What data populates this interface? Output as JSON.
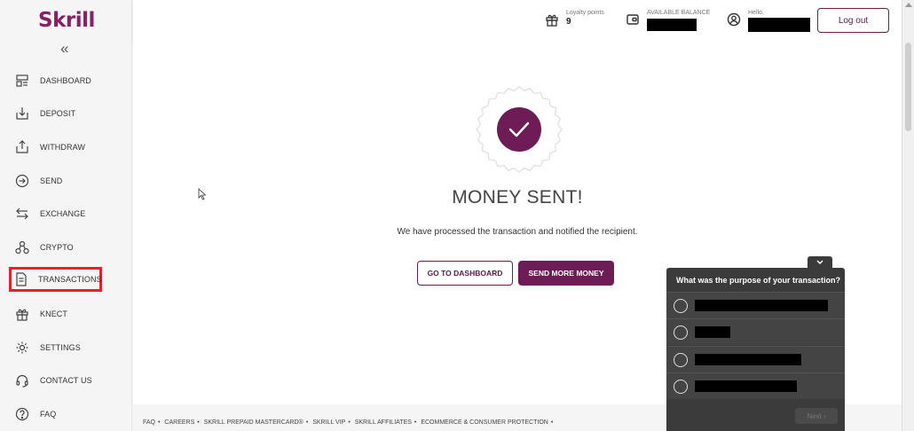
{
  "brand": {
    "logo": "Skrill",
    "accent": "#6d1c55"
  },
  "sidebar": {
    "collapse_icon": "double-chevron-left-icon",
    "items": [
      {
        "label": "DASHBOARD",
        "icon": "dashboard-icon"
      },
      {
        "label": "DEPOSIT",
        "icon": "deposit-icon"
      },
      {
        "label": "WITHDRAW",
        "icon": "withdraw-icon"
      },
      {
        "label": "SEND",
        "icon": "send-icon"
      },
      {
        "label": "EXCHANGE",
        "icon": "exchange-icon"
      },
      {
        "label": "CRYPTO",
        "icon": "crypto-icon"
      },
      {
        "label": "TRANSACTIONS",
        "icon": "transactions-icon",
        "highlighted": true
      },
      {
        "label": "KNECT",
        "icon": "gift-icon"
      },
      {
        "label": "SETTINGS",
        "icon": "gear-icon"
      },
      {
        "label": "CONTACT US",
        "icon": "headset-icon"
      },
      {
        "label": "FAQ",
        "icon": "question-icon"
      }
    ]
  },
  "header": {
    "loyalty_label": "Loyalty points",
    "loyalty_value": "9",
    "balance_label": "AVAILABLE BALANCE",
    "hello_label": "Hello,",
    "logout_label": "Log out"
  },
  "main": {
    "title": "MONEY SENT!",
    "subtitle": "We have processed the transaction and notified the recipient.",
    "btn_dashboard": "GO TO DASHBOARD",
    "btn_send_more": "SEND MORE MONEY"
  },
  "footer": {
    "links": [
      "FAQ",
      "CAREERS",
      "SKRILL PREPAID MASTERCARD®",
      "SKRILL VIP",
      "SKRILL AFFILIATES",
      "ECOMMERCE & CONSUMER PROTECTION"
    ]
  },
  "survey": {
    "question": "What was the purpose of your transaction?",
    "next_label": "Next"
  }
}
